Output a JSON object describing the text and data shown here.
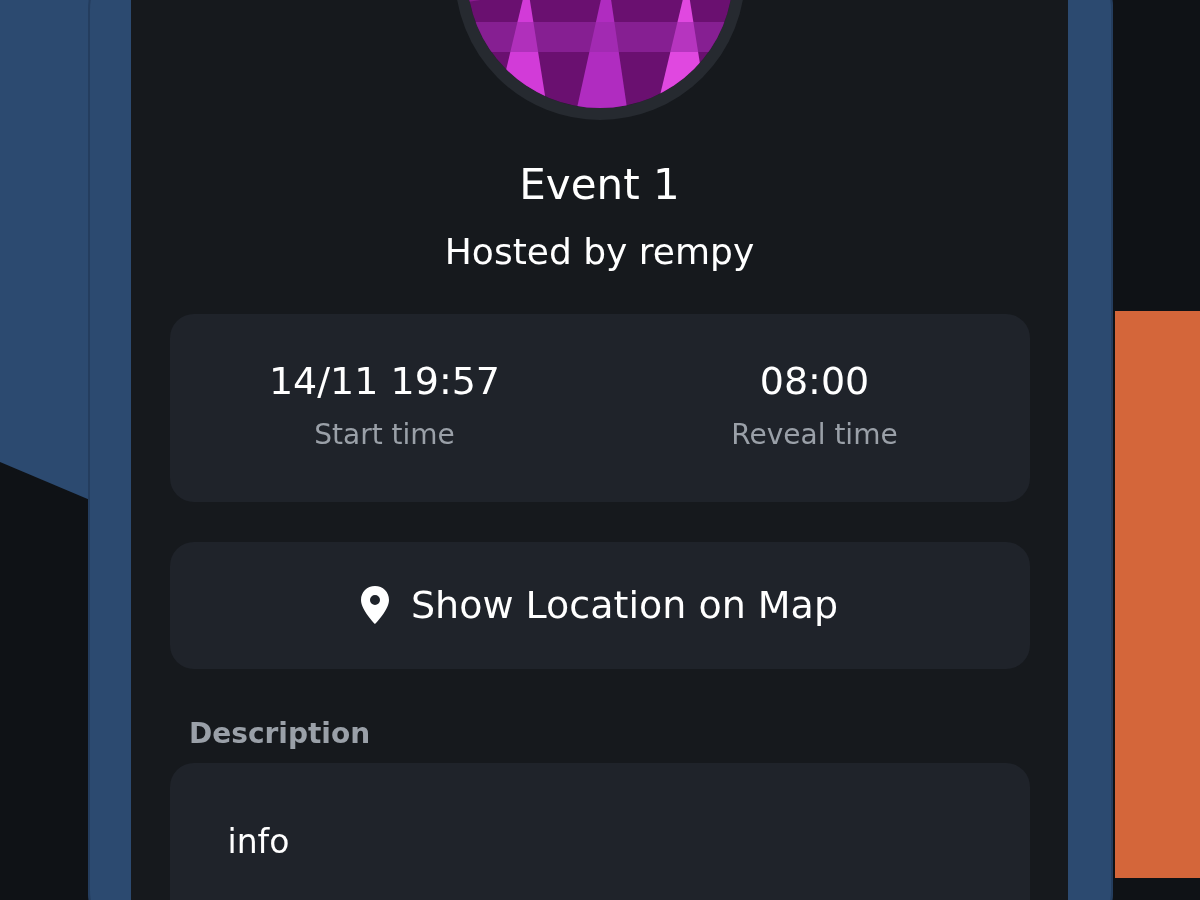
{
  "event": {
    "kind": "picture",
    "title": "Event 1",
    "host": "Hosted by rempy"
  },
  "times": [
    {
      "value": "14/11 19:57",
      "label": "Start time"
    },
    {
      "value": "08:00",
      "label": "Reveal time"
    }
  ],
  "location_button": {
    "label": "Show Location on Map"
  },
  "description": {
    "label": "Description",
    "text": "info"
  }
}
